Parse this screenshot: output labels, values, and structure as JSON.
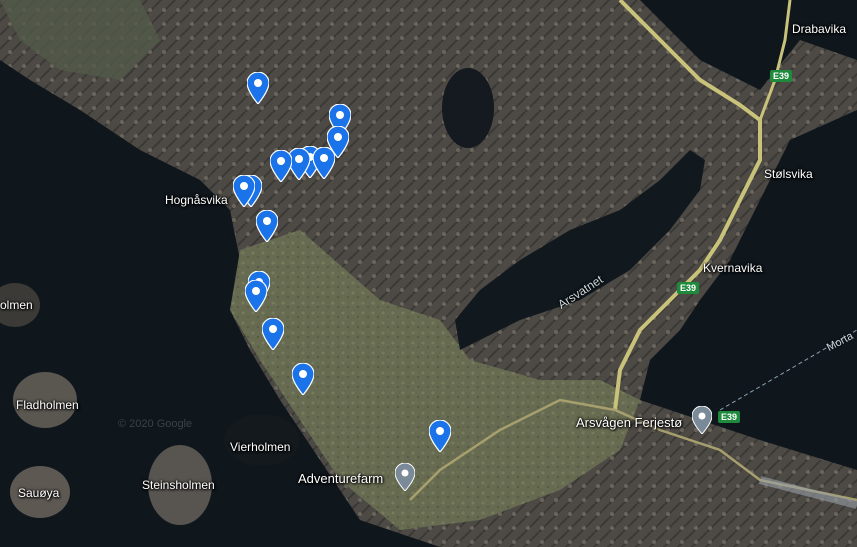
{
  "place_labels": [
    {
      "id": "drabavika",
      "text": "Drabavika"
    },
    {
      "id": "stolsvika",
      "text": "Stølsvika"
    },
    {
      "id": "hognasvika",
      "text": "Hognåsvika"
    },
    {
      "id": "kvernavika",
      "text": "Kvernavika"
    },
    {
      "id": "holmen",
      "text": "olmen"
    },
    {
      "id": "fladholmen",
      "text": "Fladholmen"
    },
    {
      "id": "vierholmen",
      "text": "Vierholmen"
    },
    {
      "id": "steinsholmen",
      "text": "Steinsholmen"
    },
    {
      "id": "sauoya",
      "text": "Sauøya"
    }
  ],
  "water_labels": [
    {
      "id": "arsvatnet",
      "text": "Arsvatnet"
    }
  ],
  "road_labels": [
    {
      "id": "morta",
      "text": "Morta"
    }
  ],
  "road_shields": [
    {
      "id": "e39-top",
      "text": "E39"
    },
    {
      "id": "e39-mid",
      "text": "E39"
    },
    {
      "id": "e39-ferry",
      "text": "E39"
    }
  ],
  "pois": [
    {
      "id": "arsvagen-ferjesto",
      "text": "Arsvågen Ferjestø"
    },
    {
      "id": "adventurefarm",
      "text": "Adventurefarm"
    }
  ],
  "copyright": "© 2020 Google",
  "marker_count": 17,
  "colors": {
    "marker": "#1a73e8",
    "poi": "#7b8a99",
    "water": "#0e141a",
    "road": "#c9c27a"
  }
}
